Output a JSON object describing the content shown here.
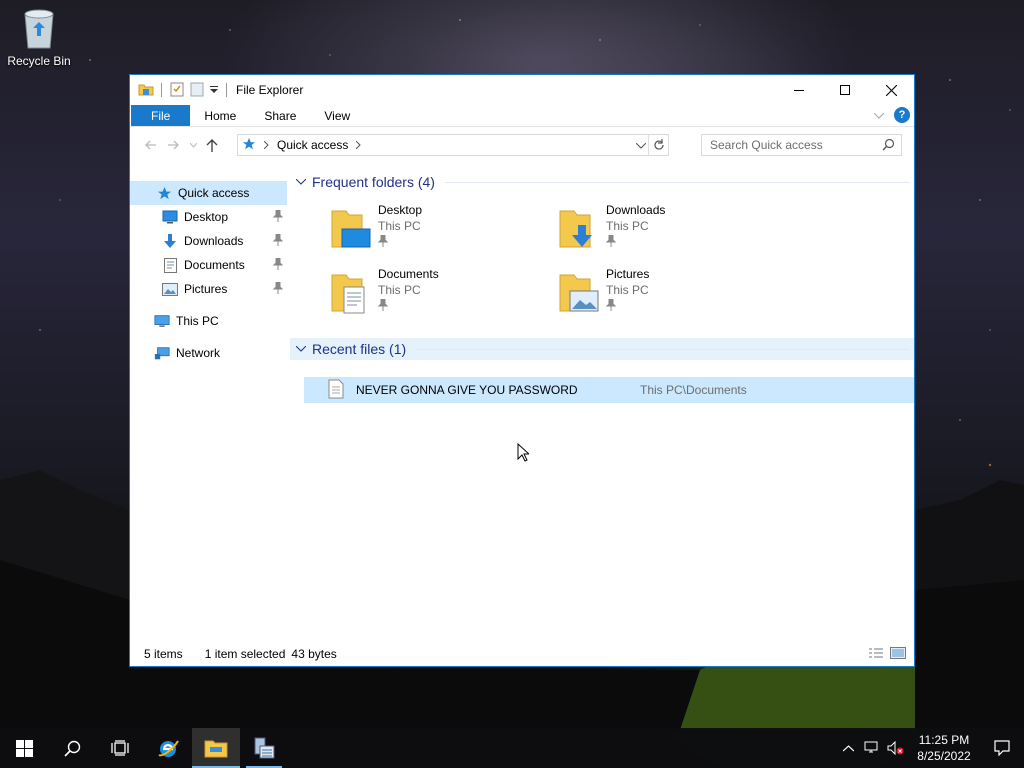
{
  "desktop": {
    "icons": [
      {
        "label": "Recycle Bin",
        "icon": "recycle-bin-icon"
      }
    ]
  },
  "window": {
    "title": "File Explorer",
    "ribbon_tabs": [
      "File",
      "Home",
      "Share",
      "View"
    ],
    "address": {
      "crumb": "Quick access"
    },
    "search": {
      "placeholder": "Search Quick access"
    },
    "nav": {
      "quick_access": "Quick access",
      "pinned": [
        {
          "label": "Desktop",
          "icon": "desktop-icon"
        },
        {
          "label": "Downloads",
          "icon": "downloads-icon"
        },
        {
          "label": "Documents",
          "icon": "documents-icon"
        },
        {
          "label": "Pictures",
          "icon": "pictures-icon"
        }
      ],
      "this_pc": "This PC",
      "network": "Network"
    },
    "frequent": {
      "header": "Frequent folders (4)",
      "folders": [
        {
          "name": "Desktop",
          "location": "This PC"
        },
        {
          "name": "Downloads",
          "location": "This PC"
        },
        {
          "name": "Documents",
          "location": "This PC"
        },
        {
          "name": "Pictures",
          "location": "This PC"
        }
      ]
    },
    "recent": {
      "header": "Recent files (1)",
      "files": [
        {
          "name": "NEVER GONNA GIVE YOU PASSWORD",
          "location": "This PC\\Documents"
        }
      ]
    },
    "status": {
      "items": "5 items",
      "selected": "1 item selected",
      "size": "43 bytes"
    }
  },
  "taskbar": {
    "clock_time": "11:25 PM",
    "clock_date": "8/25/2022",
    "accent": "#76b9ed"
  },
  "colors": {
    "accent": "#1979ca",
    "selection": "#cce8ff",
    "group_header": "#1e3287"
  }
}
